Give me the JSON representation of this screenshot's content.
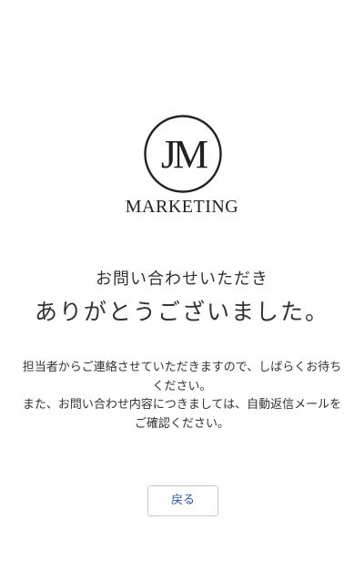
{
  "logo": {
    "monogram": "JM",
    "wordmark": "MARKETING"
  },
  "thanks": {
    "subtitle": "お問い合わせいただき",
    "title": "ありがとうございました。"
  },
  "message": {
    "line1": "担当者からご連絡させていただきますので、しばらくお待ちください。",
    "line2": "また、お問い合わせ内容につきましては、自動返信メールをご確認ください。"
  },
  "back_button": {
    "label": "戻る"
  },
  "colors": {
    "link": "#2a56a8",
    "text": "#333333",
    "border": "#c8c8c8"
  }
}
